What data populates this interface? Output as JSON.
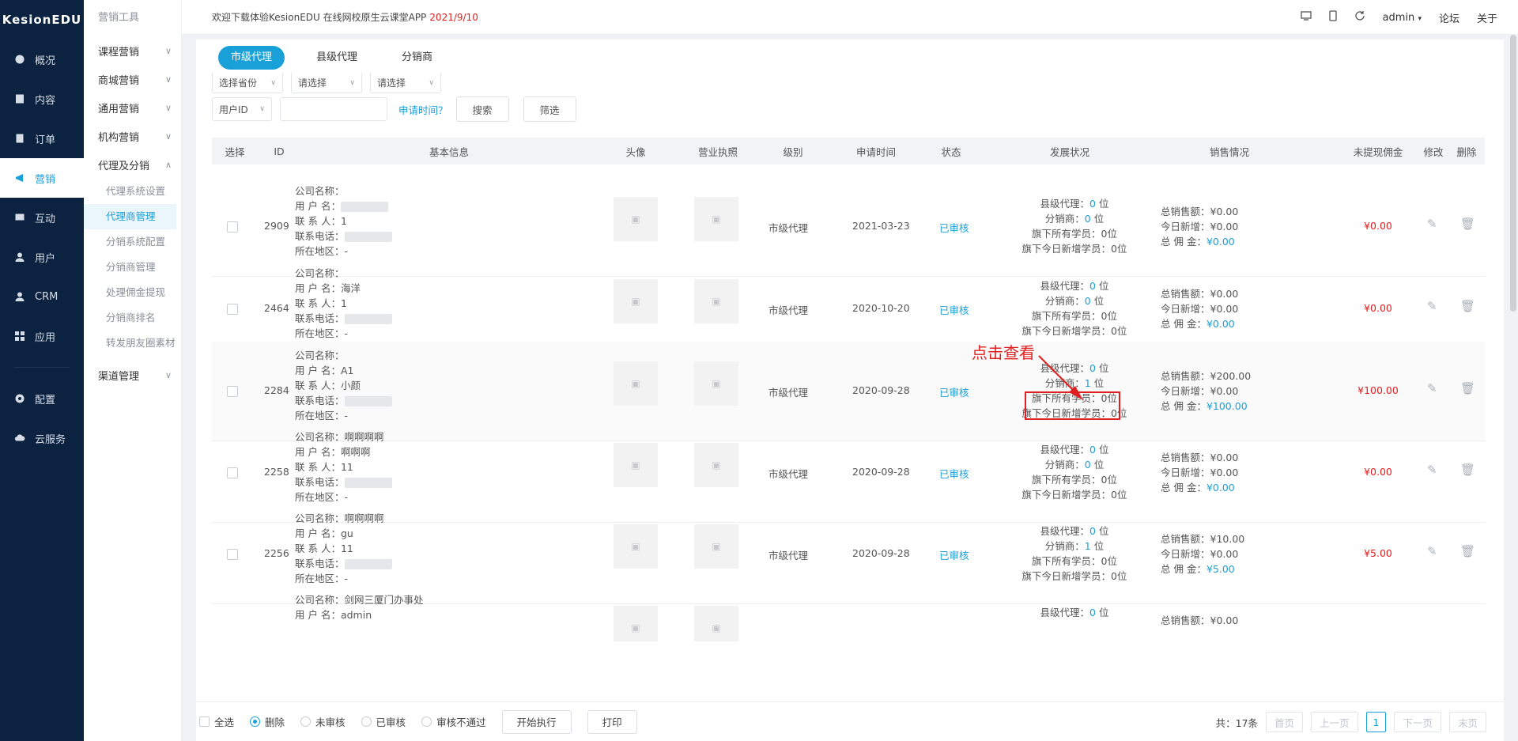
{
  "brand": "KesionEDU",
  "nav": [
    {
      "label": "概况",
      "icon": "dashboard-icon"
    },
    {
      "label": "内容",
      "icon": "content-icon"
    },
    {
      "label": "订单",
      "icon": "order-icon"
    },
    {
      "label": "营销",
      "icon": "marketing-icon"
    },
    {
      "label": "互动",
      "icon": "interaction-icon"
    },
    {
      "label": "用户",
      "icon": "user-icon"
    },
    {
      "label": "CRM",
      "icon": "crm-icon"
    },
    {
      "label": "应用",
      "icon": "apps-icon"
    },
    {
      "label": "配置",
      "icon": "settings-icon"
    },
    {
      "label": "云服务",
      "icon": "cloud-icon"
    }
  ],
  "submenu": {
    "title": "营销工具",
    "groups": [
      "课程营销",
      "商城营销",
      "通用营销",
      "机构营销",
      "代理及分销",
      "渠道管理"
    ],
    "leaves": [
      "代理系统设置",
      "代理商管理",
      "分销系统配置",
      "分销商管理",
      "处理佣金提现",
      "分销商排名",
      "转发朋友圈素材"
    ]
  },
  "header": {
    "notice": "欢迎下载体验KesionEDU 在线网校原生云课堂APP",
    "date": "2021/9/10",
    "user": "admin",
    "links": [
      "论坛",
      "关于"
    ]
  },
  "tabs": [
    "市级代理",
    "县级代理",
    "分销商"
  ],
  "filters": {
    "province": "选择省份",
    "city": "请选择",
    "district": "请选择",
    "field": "用户ID",
    "apply_time": "申请时间？",
    "search": "搜索",
    "filter": "筛选"
  },
  "columns": [
    "选择",
    "ID",
    "基本信息",
    "头像",
    "营业执照",
    "级别",
    "申请时间",
    "状态",
    "发展状况",
    "销售情况",
    "未提现佣金",
    "修改",
    "删除"
  ],
  "labels": {
    "company": "公司名称：",
    "username": "用 户 名：",
    "contact": "联 系 人：",
    "phone": "联系电话：",
    "region": "所在地区：",
    "county": "县级代理：",
    "distributor": "分销商：",
    "all_students": "旗下所有学员：",
    "today_students": "旗下今日新增学员：",
    "total_sales": "总销售额：",
    "today_new": "今日新增：",
    "total_commission": "总 佣 金："
  },
  "rows": [
    {
      "id": "2909",
      "company": "",
      "username": "",
      "contact": "1",
      "region": "-",
      "level": "市级代理",
      "date": "2021-03-23",
      "status": "已审核",
      "county": "0",
      "distributor": "0",
      "all_students": "0位",
      "today_students": "0位",
      "total_sales": "¥0.00",
      "today_sales": "¥0.00",
      "commission": "¥0.00",
      "unpaid": "¥0.00"
    },
    {
      "id": "2464",
      "company": "",
      "username": "海洋",
      "contact": "1",
      "region": "-",
      "level": "市级代理",
      "date": "2020-10-20",
      "status": "已审核",
      "county": "0",
      "distributor": "0",
      "all_students": "0位",
      "today_students": "0位",
      "total_sales": "¥0.00",
      "today_sales": "¥0.00",
      "commission": "¥0.00",
      "unpaid": "¥0.00"
    },
    {
      "id": "2284",
      "company": "",
      "username": "A1",
      "contact": "小颜",
      "region": "-",
      "level": "市级代理",
      "date": "2020-09-28",
      "status": "已审核",
      "county": "0",
      "distributor": "1",
      "all_students": "0位",
      "today_students": "0位",
      "total_sales": "¥200.00",
      "today_sales": "¥0.00",
      "commission": "¥100.00",
      "unpaid": "¥100.00"
    },
    {
      "id": "2258",
      "company": "啊啊啊啊",
      "username": "啊啊啊",
      "contact": "11",
      "region": "-",
      "level": "市级代理",
      "date": "2020-09-28",
      "status": "已审核",
      "county": "0",
      "distributor": "0",
      "all_students": "0位",
      "today_students": "0位",
      "total_sales": "¥0.00",
      "today_sales": "¥0.00",
      "commission": "¥0.00",
      "unpaid": "¥0.00"
    },
    {
      "id": "2256",
      "company": "啊啊啊啊",
      "username": "gu",
      "contact": "11",
      "region": "-",
      "level": "市级代理",
      "date": "2020-09-28",
      "status": "已审核",
      "county": "0",
      "distributor": "1",
      "all_students": "0位",
      "today_students": "0位",
      "total_sales": "¥10.00",
      "today_sales": "¥0.00",
      "commission": "¥5.00",
      "unpaid": "¥5.00"
    },
    {
      "company": "剑网三厦门办事处",
      "username": "admin",
      "county": "0",
      "total_sales": "¥0.00"
    }
  ],
  "unit": "位",
  "annotation": "点击查看",
  "footer": {
    "select_all": "全选",
    "options": [
      "删除",
      "未审核",
      "已审核",
      "审核不通过"
    ],
    "execute": "开始执行",
    "print": "打印",
    "total": "共：17条",
    "first": "首页",
    "prev": "上一页",
    "page": "1",
    "next": "下一页",
    "last": "末页"
  }
}
